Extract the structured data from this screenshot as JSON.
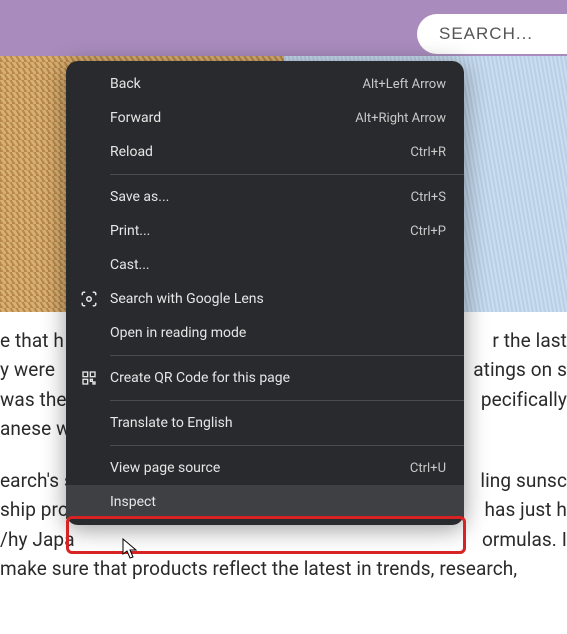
{
  "header": {
    "search_placeholder": "SEARCH..."
  },
  "context_menu": {
    "items": [
      {
        "label": "Back",
        "shortcut": "Alt+Left Arrow"
      },
      {
        "label": "Forward",
        "shortcut": "Alt+Right Arrow"
      },
      {
        "label": "Reload",
        "shortcut": "Ctrl+R"
      }
    ],
    "group2": [
      {
        "label": "Save as...",
        "shortcut": "Ctrl+S"
      },
      {
        "label": "Print...",
        "shortcut": "Ctrl+P"
      },
      {
        "label": "Cast..."
      }
    ],
    "lens": {
      "label": "Search with Google Lens"
    },
    "reading": {
      "label": "Open in reading mode"
    },
    "qr": {
      "label": "Create QR Code for this page"
    },
    "translate": {
      "label": "Translate to English"
    },
    "source": {
      "label": "View page source",
      "shortcut": "Ctrl+U"
    },
    "inspect": {
      "label": "Inspect"
    }
  },
  "article": {
    "l1": "e that h",
    "r1": "r the last ",
    "l2": "y were",
    "r2": "atings on s",
    "l3": " was the",
    "r3": "pecifically ",
    "l4": "anese w",
    "l5": "earch's s",
    "r5": "ling sunsc",
    "l6": "ship pro",
    "r6": "has just h",
    "l7": "/hy Japa",
    "r7": "ormulas. I",
    "l8": "make sure that products reflect the latest in trends, research,"
  }
}
